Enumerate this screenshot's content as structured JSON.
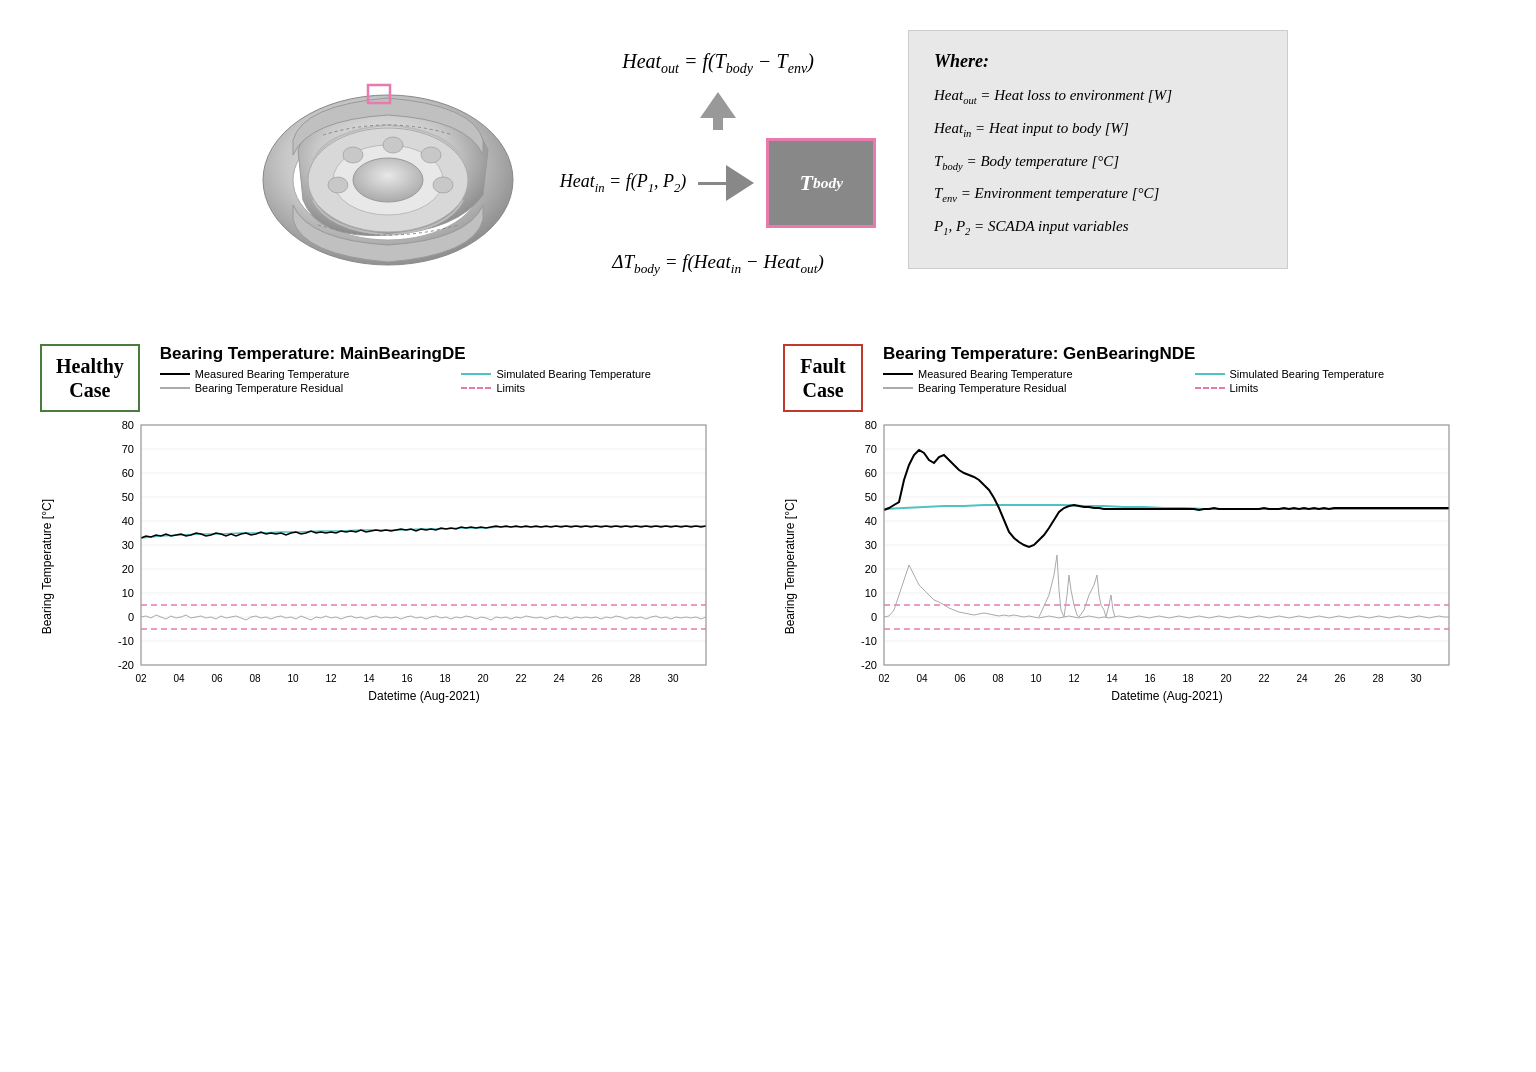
{
  "top": {
    "equations": {
      "heat_out": "Heat_out = f(T_body − T_env)",
      "heat_in": "Heat_in = f(P₁, P₂)",
      "t_body": "T_body",
      "delta_t": "ΔT_body = f(Heat_in − Heat_out)"
    },
    "legend": {
      "where_label": "Where:",
      "items": [
        "Heat_out = Heat loss to environment [W]",
        "Heat_in = Heat input to body [W]",
        "T_body = Body temperature [°C]",
        "T_env = Environment temperature [°C]",
        "P₁, P₂ = SCADA input variables"
      ]
    }
  },
  "charts": {
    "healthy": {
      "case_label": "Healthy\nCase",
      "title": "Bearing Temperature: MainBearingDE",
      "y_axis_label": "Bearing Temperature [°C]",
      "x_axis_label": "Datetime (Aug-2021)",
      "legend": [
        {
          "label": "Measured Bearing Temperature",
          "color": "#000000",
          "dashed": false
        },
        {
          "label": "Simulated Bearing Temperature",
          "color": "#4fc3c3",
          "dashed": false
        },
        {
          "label": "Bearing Temperature Residual",
          "color": "#aaaaaa",
          "dashed": false
        },
        {
          "label": "Limits",
          "color": "#e87ab0",
          "dashed": true
        }
      ],
      "y_min": -20,
      "y_max": 80,
      "x_ticks": [
        "02",
        "04",
        "06",
        "08",
        "10",
        "12",
        "14",
        "16",
        "18",
        "20",
        "22",
        "24",
        "26",
        "28",
        "30"
      ]
    },
    "fault": {
      "case_label": "Fault\nCase",
      "title": "Bearing Temperature: GenBearingNDE",
      "y_axis_label": "Bearing Temperature [°C]",
      "x_axis_label": "Datetime (Aug-2021)",
      "legend": [
        {
          "label": "Measured Bearing Temperature",
          "color": "#000000",
          "dashed": false
        },
        {
          "label": "Simulated Bearing Temperature",
          "color": "#4fc3c3",
          "dashed": false
        },
        {
          "label": "Bearing Temperature Residual",
          "color": "#aaaaaa",
          "dashed": false
        },
        {
          "label": "Limits",
          "color": "#e87ab0",
          "dashed": true
        }
      ],
      "y_min": -20,
      "y_max": 80,
      "x_ticks": [
        "02",
        "04",
        "06",
        "08",
        "10",
        "12",
        "14",
        "16",
        "18",
        "20",
        "22",
        "24",
        "26",
        "28",
        "30"
      ]
    }
  }
}
